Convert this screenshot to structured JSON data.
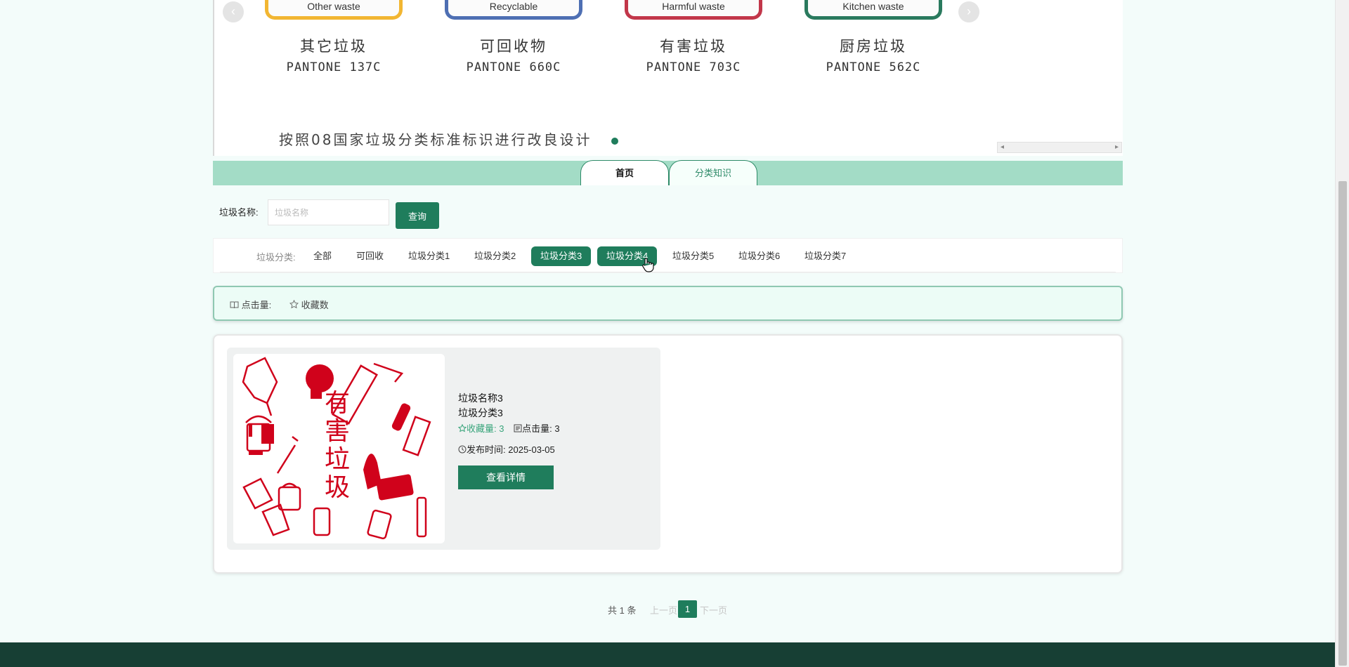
{
  "banner": {
    "bins": [
      {
        "en": "Other waste",
        "cn": "其它垃圾",
        "pantone": "PANTONE 137C",
        "color": "#f2b632"
      },
      {
        "en": "Recyclable",
        "cn": "可回收物",
        "pantone": "PANTONE 660C",
        "color": "#4e6fb3"
      },
      {
        "en": "Harmful waste",
        "cn": "有害垃圾",
        "pantone": "PANTONE 703C",
        "color": "#c2374a"
      },
      {
        "en": "Kitchen waste",
        "cn": "厨房垃圾",
        "pantone": "PANTONE 562C",
        "color": "#2a7a5e"
      }
    ],
    "caption": "按照08国家垃圾分类标准标识进行改良设计",
    "prev_arrow": "‹",
    "next_arrow": "›"
  },
  "nav": {
    "tabs": [
      {
        "label": "首页",
        "active": true
      },
      {
        "label": "分类知识",
        "active": false
      }
    ]
  },
  "search": {
    "label": "垃圾名称:",
    "placeholder": "垃圾名称",
    "button": "查询"
  },
  "filter": {
    "label": "垃圾分类:",
    "categories": [
      "全部",
      "可回收",
      "垃圾分类1",
      "垃圾分类2",
      "垃圾分类3",
      "垃圾分类4",
      "垃圾分类5",
      "垃圾分类6",
      "垃圾分类7"
    ],
    "selected": [
      "垃圾分类3",
      "垃圾分类4"
    ]
  },
  "sort": {
    "clicks_label": "点击量:",
    "favorites_label": "收藏数"
  },
  "items": [
    {
      "name": "垃圾名称3",
      "category": "垃圾分类3",
      "favorites_label": "收藏量:",
      "favorites": "3",
      "clicks_label": "点击量:",
      "clicks": "3",
      "time_label": "发布时间:",
      "time": "2025-03-05",
      "button": "查看详情",
      "image_text": [
        "有",
        "害",
        "垃",
        "圾"
      ]
    }
  ],
  "pagination": {
    "total": "共 1 条",
    "prev": "上一页",
    "page": "1",
    "next": "下一页"
  },
  "colors": {
    "primary": "#1f7d5c",
    "nav_bg": "#a3dcc6",
    "page_bg": "#f3fcfa",
    "footer": "#173f34",
    "harmful_red": "#d0021b"
  },
  "icons": [
    "book-icon",
    "star-icon",
    "note-icon",
    "clock-icon"
  ]
}
